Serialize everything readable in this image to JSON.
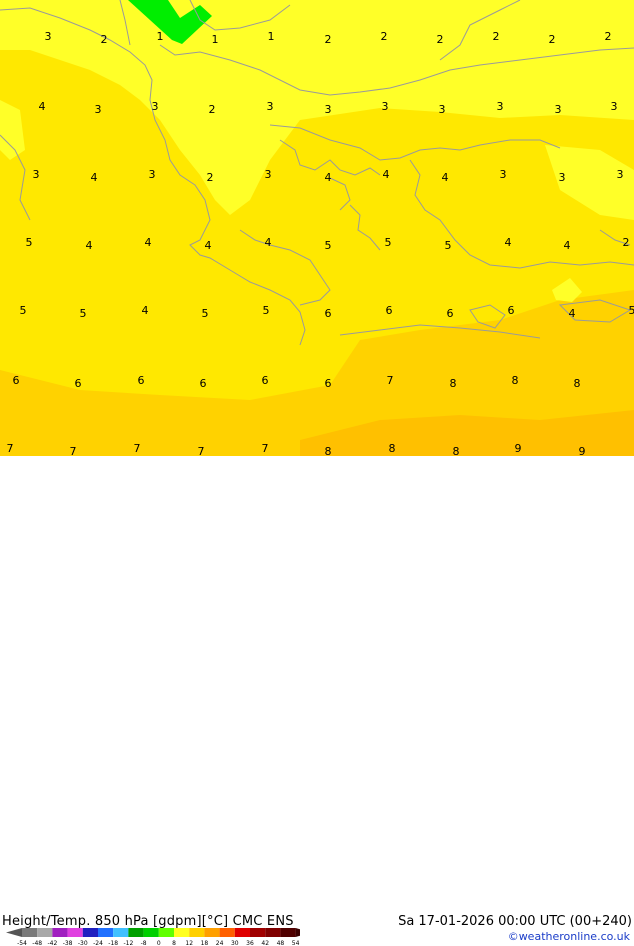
{
  "header": {
    "title": "Height/Temp. 850 hPa [gdpm][°C] CMC ENS",
    "datetime": "Sa 17-01-2026 00:00 UTC (00+240)"
  },
  "footer": {
    "credit": "©weatheronline.co.uk"
  },
  "colorbar": {
    "ticks": [
      "-54",
      "-48",
      "-42",
      "-38",
      "-30",
      "-24",
      "-18",
      "-12",
      "-8",
      "0",
      "8",
      "12",
      "18",
      "24",
      "30",
      "36",
      "42",
      "48",
      "54"
    ],
    "colors": [
      "#7a7a7a",
      "#a8a8a8",
      "#a020c0",
      "#e040e0",
      "#2020c0",
      "#2070ff",
      "#40c0ff",
      "#00a000",
      "#00d000",
      "#60ff00",
      "#ffff20",
      "#ffd000",
      "#ffa000",
      "#ff6000",
      "#e00000",
      "#a00000",
      "#800000",
      "#500000"
    ]
  },
  "map": {
    "colors": {
      "yellow_light": "#ffff28",
      "yellow": "#ffe800",
      "yellow_deep": "#ffd200",
      "orange": "#ffc000",
      "green": "#00ee00",
      "coast": "#9a9a9a"
    },
    "labels": [
      {
        "value": "3",
        "row": 0,
        "col": 0
      },
      {
        "value": "2",
        "row": 0,
        "col": 1
      },
      {
        "value": "1",
        "row": 0,
        "col": 2
      },
      {
        "value": "1",
        "row": 0,
        "col": 3
      },
      {
        "value": "1",
        "row": 0,
        "col": 4
      },
      {
        "value": "2",
        "row": 0,
        "col": 5
      },
      {
        "value": "2",
        "row": 0,
        "col": 6
      },
      {
        "value": "2",
        "row": 0,
        "col": 7
      },
      {
        "value": "2",
        "row": 0,
        "col": 8
      },
      {
        "value": "2",
        "row": 0,
        "col": 9
      },
      {
        "value": "2",
        "row": 0,
        "col": 10
      },
      {
        "value": "4",
        "row": 1,
        "col": 0
      },
      {
        "value": "3",
        "row": 1,
        "col": 1
      },
      {
        "value": "3",
        "row": 1,
        "col": 2
      },
      {
        "value": "2",
        "row": 1,
        "col": 3
      },
      {
        "value": "3",
        "row": 1,
        "col": 4
      },
      {
        "value": "3",
        "row": 1,
        "col": 5
      },
      {
        "value": "3",
        "row": 1,
        "col": 6
      },
      {
        "value": "3",
        "row": 1,
        "col": 7
      },
      {
        "value": "3",
        "row": 1,
        "col": 8
      },
      {
        "value": "3",
        "row": 1,
        "col": 9
      },
      {
        "value": "3",
        "row": 1,
        "col": 10
      },
      {
        "value": "3",
        "row": 2,
        "col": 0
      },
      {
        "value": "4",
        "row": 2,
        "col": 1
      },
      {
        "value": "3",
        "row": 2,
        "col": 2
      },
      {
        "value": "2",
        "row": 2,
        "col": 3
      },
      {
        "value": "3",
        "row": 2,
        "col": 4
      },
      {
        "value": "4",
        "row": 2,
        "col": 5
      },
      {
        "value": "4",
        "row": 2,
        "col": 6
      },
      {
        "value": "4",
        "row": 2,
        "col": 7
      },
      {
        "value": "3",
        "row": 2,
        "col": 8
      },
      {
        "value": "3",
        "row": 2,
        "col": 9
      },
      {
        "value": "3",
        "row": 2,
        "col": 10
      },
      {
        "value": "5",
        "row": 3,
        "col": 0
      },
      {
        "value": "4",
        "row": 3,
        "col": 1
      },
      {
        "value": "4",
        "row": 3,
        "col": 2
      },
      {
        "value": "4",
        "row": 3,
        "col": 3
      },
      {
        "value": "4",
        "row": 3,
        "col": 4
      },
      {
        "value": "5",
        "row": 3,
        "col": 5
      },
      {
        "value": "5",
        "row": 3,
        "col": 6
      },
      {
        "value": "5",
        "row": 3,
        "col": 7
      },
      {
        "value": "4",
        "row": 3,
        "col": 8
      },
      {
        "value": "4",
        "row": 3,
        "col": 9
      },
      {
        "value": "2",
        "row": 3,
        "col": 10
      },
      {
        "value": "5",
        "row": 4,
        "col": 0
      },
      {
        "value": "5",
        "row": 4,
        "col": 1
      },
      {
        "value": "4",
        "row": 4,
        "col": 2
      },
      {
        "value": "5",
        "row": 4,
        "col": 3
      },
      {
        "value": "5",
        "row": 4,
        "col": 4
      },
      {
        "value": "6",
        "row": 4,
        "col": 5
      },
      {
        "value": "6",
        "row": 4,
        "col": 6
      },
      {
        "value": "6",
        "row": 4,
        "col": 7
      },
      {
        "value": "6",
        "row": 4,
        "col": 8
      },
      {
        "value": "4",
        "row": 4,
        "col": 9
      },
      {
        "value": "5",
        "row": 4,
        "col": 10
      },
      {
        "value": "6",
        "row": 5,
        "col": 0
      },
      {
        "value": "6",
        "row": 5,
        "col": 1
      },
      {
        "value": "6",
        "row": 5,
        "col": 2
      },
      {
        "value": "6",
        "row": 5,
        "col": 3
      },
      {
        "value": "6",
        "row": 5,
        "col": 4
      },
      {
        "value": "6",
        "row": 5,
        "col": 5
      },
      {
        "value": "7",
        "row": 5,
        "col": 6
      },
      {
        "value": "8",
        "row": 5,
        "col": 7
      },
      {
        "value": "8",
        "row": 5,
        "col": 8
      },
      {
        "value": "8",
        "row": 5,
        "col": 9
      },
      {
        "value": "7",
        "row": 6,
        "col": 0
      },
      {
        "value": "7",
        "row": 6,
        "col": 1
      },
      {
        "value": "7",
        "row": 6,
        "col": 2
      },
      {
        "value": "7",
        "row": 6,
        "col": 3
      },
      {
        "value": "7",
        "row": 6,
        "col": 4
      },
      {
        "value": "8",
        "row": 6,
        "col": 5
      },
      {
        "value": "8",
        "row": 6,
        "col": 6
      },
      {
        "value": "8",
        "row": 6,
        "col": 7
      },
      {
        "value": "9",
        "row": 6,
        "col": 8
      },
      {
        "value": "9",
        "row": 6,
        "col": 9
      }
    ]
  }
}
